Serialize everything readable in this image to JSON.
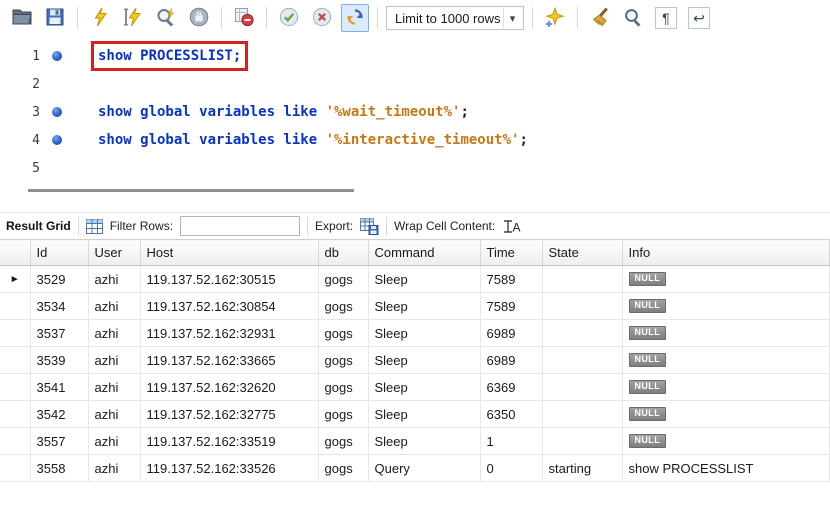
{
  "toolbar": {
    "limit_dropdown": {
      "value": "Limit to 1000 rows"
    },
    "icons": [
      "open-script",
      "save-script",
      "execute",
      "execute-current-statement",
      "explain-plan",
      "stop-query",
      "toggle-stop-on-error",
      "commit",
      "rollback",
      "toggle-autocommit",
      "beautify-script",
      "clean-editor",
      "find",
      "show-invisibles",
      "wrap-text"
    ]
  },
  "editor": {
    "lines": [
      {
        "num": "1",
        "marker": true,
        "highlight": true,
        "segments": [
          {
            "t": "show PROCESSLIST;",
            "c": "kw"
          }
        ]
      },
      {
        "num": "2",
        "marker": false,
        "highlight": false,
        "segments": []
      },
      {
        "num": "3",
        "marker": true,
        "highlight": false,
        "segments": [
          {
            "t": "show global variables like ",
            "c": "kw"
          },
          {
            "t": "'%wait_timeout%'",
            "c": "str"
          },
          {
            "t": ";",
            "c": "pl"
          }
        ]
      },
      {
        "num": "4",
        "marker": true,
        "highlight": false,
        "segments": [
          {
            "t": "show global variables like ",
            "c": "kw"
          },
          {
            "t": "'%interactive_timeout%'",
            "c": "str"
          },
          {
            "t": ";",
            "c": "pl"
          }
        ]
      },
      {
        "num": "5",
        "marker": false,
        "highlight": false,
        "segments": []
      }
    ]
  },
  "result_toolbar": {
    "result_grid_label": "Result Grid",
    "filter_label": "Filter Rows:",
    "filter_value": "",
    "export_label": "Export:",
    "wrap_label": "Wrap Cell Content:",
    "icons": [
      "result-grid",
      "export-recordset",
      "wrap-cell-content"
    ]
  },
  "grid": {
    "columns": [
      "Id",
      "User",
      "Host",
      "db",
      "Command",
      "Time",
      "State",
      "Info"
    ],
    "rows": [
      {
        "current": true,
        "id": "3529",
        "user": "azhi",
        "host": "119.137.52.162:30515",
        "db": "gogs",
        "command": "Sleep",
        "time": "7589",
        "state": "",
        "info": "NULL",
        "info_null": true
      },
      {
        "current": false,
        "id": "3534",
        "user": "azhi",
        "host": "119.137.52.162:30854",
        "db": "gogs",
        "command": "Sleep",
        "time": "7589",
        "state": "",
        "info": "NULL",
        "info_null": true
      },
      {
        "current": false,
        "id": "3537",
        "user": "azhi",
        "host": "119.137.52.162:32931",
        "db": "gogs",
        "command": "Sleep",
        "time": "6989",
        "state": "",
        "info": "NULL",
        "info_null": true
      },
      {
        "current": false,
        "id": "3539",
        "user": "azhi",
        "host": "119.137.52.162:33665",
        "db": "gogs",
        "command": "Sleep",
        "time": "6989",
        "state": "",
        "info": "NULL",
        "info_null": true
      },
      {
        "current": false,
        "id": "3541",
        "user": "azhi",
        "host": "119.137.52.162:32620",
        "db": "gogs",
        "command": "Sleep",
        "time": "6369",
        "state": "",
        "info": "NULL",
        "info_null": true
      },
      {
        "current": false,
        "id": "3542",
        "user": "azhi",
        "host": "119.137.52.162:32775",
        "db": "gogs",
        "command": "Sleep",
        "time": "6350",
        "state": "",
        "info": "NULL",
        "info_null": true
      },
      {
        "current": false,
        "id": "3557",
        "user": "azhi",
        "host": "119.137.52.162:33519",
        "db": "gogs",
        "command": "Sleep",
        "time": "1",
        "state": "",
        "info": "NULL",
        "info_null": true
      },
      {
        "current": false,
        "id": "3558",
        "user": "azhi",
        "host": "119.137.52.162:33526",
        "db": "gogs",
        "command": "Query",
        "time": "0",
        "state": "starting",
        "info": "show PROCESSLIST",
        "info_null": false
      }
    ]
  },
  "colors": {
    "keyword": "#0832c8",
    "string": "#c87617",
    "annotation_box": "#d62020",
    "toggle_selection": "#7ab0e8",
    "null_badge_bg": "#8f8f8f"
  }
}
